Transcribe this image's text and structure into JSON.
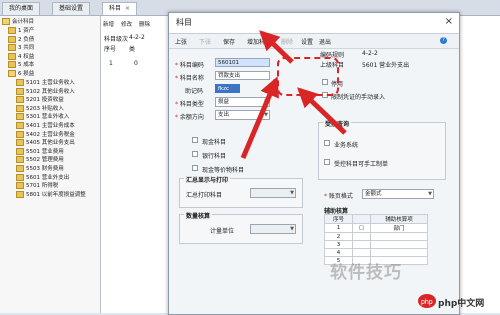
{
  "app_tabs": [
    {
      "label": "我的桌面"
    },
    {
      "label": "基础设置"
    },
    {
      "label": "科目",
      "close": "×"
    }
  ],
  "tree": {
    "root": "会计科目",
    "items": [
      "1 资产",
      "2 负债",
      "3 共同",
      "4 权益",
      "5 成本",
      "6 损益",
      "5101 主营业务收入",
      "5102 其他业务收入",
      "5201 投资收益",
      "5203 补贴收入",
      "5301 营业外收入",
      "5401 主营业务成本",
      "5402 主营业务税金",
      "5405 其他业务支出",
      "5501 营业费用",
      "5502 管理费用",
      "5503 财务费用",
      "5601 营业外支出",
      "5701 所得税",
      "5801 以前年度损益调整"
    ]
  },
  "list_panel": {
    "toolbar": [
      "新增",
      "修改",
      "删除"
    ],
    "col_headers": [
      "科目级次",
      "4-2-2",
      "序号",
      "类"
    ],
    "row": [
      "1",
      "0"
    ]
  },
  "dialog": {
    "title": "科目",
    "close": "×",
    "toolbar": [
      "上张",
      "下张",
      "保存",
      "增加科目",
      "删除",
      "设置",
      "退出"
    ],
    "help": "?",
    "fields": {
      "code_label": "科目编码",
      "code_value": "560101",
      "name_label": "科目名称",
      "name_value": "罚款支出",
      "mnemonic_label": "助记码",
      "mnemonic_value": "fkzc",
      "type_label": "科目类型",
      "type_value": "损益",
      "direction_label": "余额方向",
      "direction_value": "支出",
      "coding_rule_label": "编码规则",
      "coding_rule_value": "4-2-2",
      "parent_label": "上级科目",
      "parent_value": "5601 营业外支出"
    },
    "checks_right": [
      "停用",
      "限制凭证的手动录入"
    ],
    "checks_left": [
      "现金科目",
      "银行科目",
      "现金等价物科目"
    ],
    "group_summary": {
      "title": "汇总显示与打印",
      "label": "汇总打印科目"
    },
    "group_qty": {
      "title": "数量核算",
      "label": "计量单位"
    },
    "group_query": {
      "title": "受控查询",
      "items": [
        "业务系统",
        "受控科目可手工制单"
      ]
    },
    "account_format_label": "账页格式",
    "account_format_value": "金额式",
    "aux_table": {
      "title": "辅助核算",
      "headers": [
        "序号",
        "",
        "辅助核算项"
      ],
      "rows": [
        [
          "1",
          "部门"
        ],
        [
          "2",
          ""
        ],
        [
          "3",
          ""
        ],
        [
          "4",
          ""
        ],
        [
          "5",
          ""
        ]
      ]
    }
  },
  "watermark": "软件技巧",
  "logo_text": "php中文网",
  "colors": {
    "highlight": "#d92525",
    "accent": "#3b74c4"
  }
}
